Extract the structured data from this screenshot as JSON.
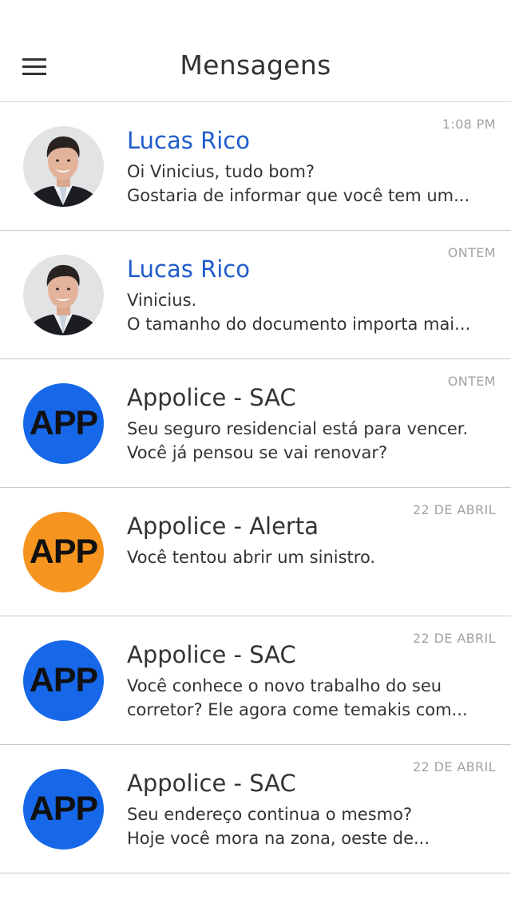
{
  "header": {
    "title": "Mensagens",
    "menu_icon": "hamburger-menu-icon"
  },
  "colors": {
    "unread_sender": "#1f5ccc",
    "app_blue": "#1768e8",
    "app_orange": "#f59520",
    "timestamp": "#a3a3a3",
    "divider": "#c9c9c9"
  },
  "messages": [
    {
      "sender": "Lucas Rico",
      "time": "1:08 PM",
      "line1": "Oi Vinicius, tudo bom?",
      "line2": "Gostaria de informar que você tem um...",
      "avatar": "photo",
      "unread": true
    },
    {
      "sender": "Lucas Rico",
      "time": "ONTEM",
      "line1": "Vinicius.",
      "line2": "O tamanho do documento importa mai...",
      "avatar": "photo",
      "unread": true
    },
    {
      "sender": "Appolice - SAC",
      "time": "ONTEM",
      "line1": "Seu seguro residencial está para vencer.",
      "line2": "Você já pensou se vai renovar?",
      "avatar": "APP",
      "avatar_color": "#1768e8",
      "unread": false
    },
    {
      "sender": "Appolice - Alerta",
      "time": "22 DE ABRIL",
      "line1": "Você tentou abrir um sinistro.",
      "line2": "",
      "avatar": "APP",
      "avatar_color": "#f59520",
      "unread": false
    },
    {
      "sender": "Appolice - SAC",
      "time": "22 DE ABRIL",
      "line1": "Você conhece o novo trabalho do seu",
      "line2": "corretor? Ele agora come temakis com...",
      "avatar": "APP",
      "avatar_color": "#1768e8",
      "unread": false
    },
    {
      "sender": "Appolice - SAC",
      "time": "22 DE ABRIL",
      "line1": "Seu endereço continua o mesmo?",
      "line2": "Hoje você mora na zona, oeste de...",
      "avatar": "APP",
      "avatar_color": "#1768e8",
      "unread": false
    }
  ]
}
